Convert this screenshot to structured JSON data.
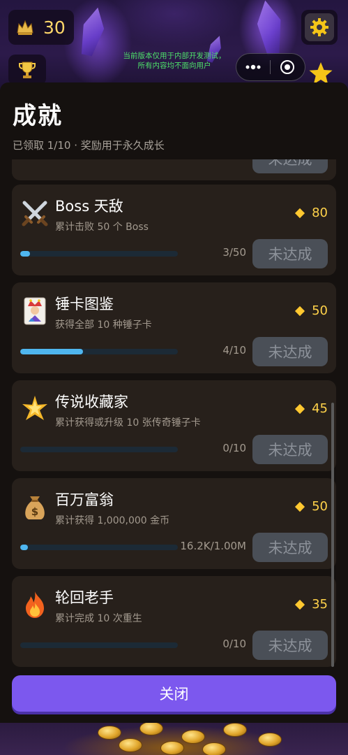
{
  "hud": {
    "score": "30",
    "notice_line1": "当前版本仅用于内部开发测试，",
    "notice_line2": "所有内容均不面向用户"
  },
  "panel": {
    "title": "成就",
    "subtitle": "已领取 1/10 · 奖励用于永久成长",
    "close_label": "关闭"
  },
  "achievements": [
    {
      "icon": "crossed-swords-icon",
      "title": "Boss 天敌",
      "desc": "累计击败 50 个 Boss",
      "reward": "80",
      "progress_text": "3/50",
      "progress_fraction": 0.06,
      "status": "未达成"
    },
    {
      "icon": "joker-card-icon",
      "title": "锤卡图鉴",
      "desc": "获得全部 10 种锤子卡",
      "reward": "50",
      "progress_text": "4/10",
      "progress_fraction": 0.4,
      "status": "未达成"
    },
    {
      "icon": "sparkle-star-icon",
      "title": "传说收藏家",
      "desc": "累计获得或升级 10 张传奇锤子卡",
      "reward": "45",
      "progress_text": "0/10",
      "progress_fraction": 0,
      "status": "未达成"
    },
    {
      "icon": "money-bag-icon",
      "title": "百万富翁",
      "desc": "累计获得 1,000,000 金币",
      "reward": "50",
      "progress_text": "16.2K/1.00M",
      "progress_fraction": 0.016,
      "status": "未达成"
    },
    {
      "icon": "fire-icon",
      "title": "轮回老手",
      "desc": "累计完成 10 次重生",
      "reward": "35",
      "progress_text": "0/10",
      "progress_fraction": 0,
      "status": "未达成"
    }
  ],
  "colors": {
    "accent": "#7c58ee",
    "gold": "#ffd24a",
    "progress": "#4fb6ef",
    "card": "#27201b"
  }
}
